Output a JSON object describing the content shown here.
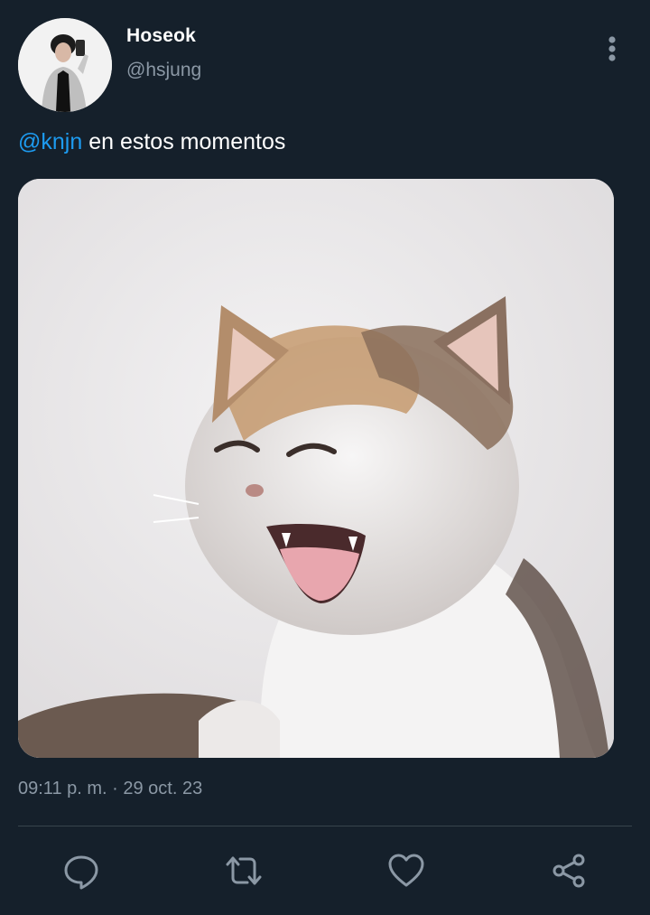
{
  "author": {
    "display_name": "Hoseok",
    "handle": "@hsjung"
  },
  "tweet": {
    "mention": "@knjn",
    "text": " en estos momentos",
    "timestamp": "09:11 p. m. · 29 oct. 23"
  },
  "icons": {
    "more": "more-vertical-icon",
    "reply": "reply-icon",
    "retweet": "retweet-icon",
    "like": "heart-icon",
    "share": "share-icon"
  },
  "colors": {
    "background": "#15202b",
    "mention": "#1d9bf0",
    "secondary_text": "#8b98a5",
    "divider": "#38444d"
  }
}
